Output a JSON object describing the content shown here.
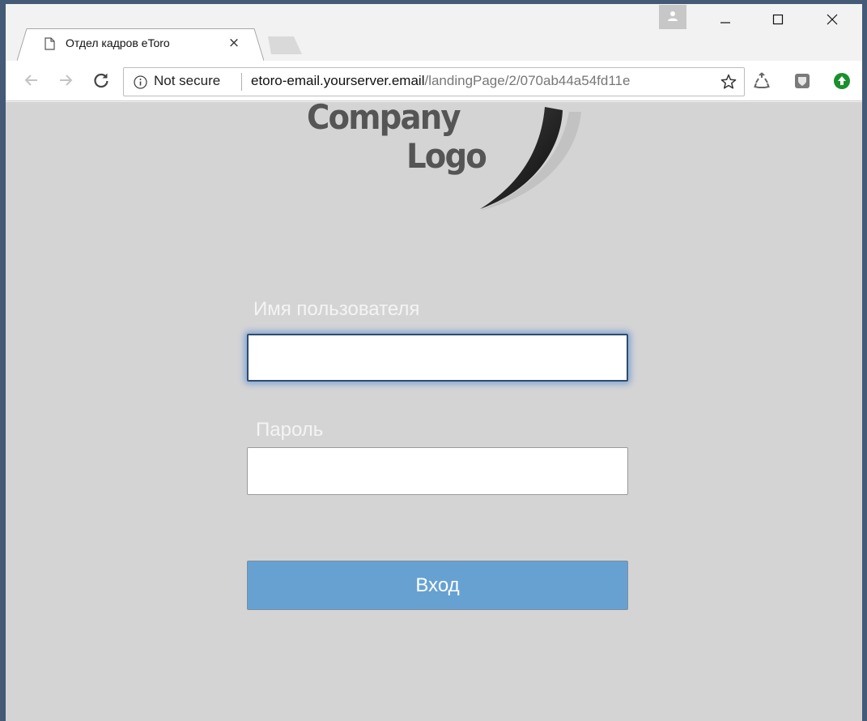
{
  "browser": {
    "tab": {
      "title": "Отдел кадров eToro",
      "close": "×"
    },
    "address_bar": {
      "security_label": "Not secure",
      "url_host": "etoro-email.yourserver.email",
      "url_path": "/landingPage/2/070ab44a54fd11e"
    }
  },
  "page": {
    "logo": {
      "line1": "Company",
      "line2": "Logo"
    },
    "form": {
      "username_label": "Имя пользователя",
      "username_value": "",
      "password_label": "Пароль",
      "password_value": "",
      "submit_label": "Вход"
    }
  },
  "colors": {
    "desktop_bg": "#445a76",
    "page_bg": "#d5d4d5",
    "button_bg": "#66a1d2",
    "focus_glow": "#6496d2"
  }
}
